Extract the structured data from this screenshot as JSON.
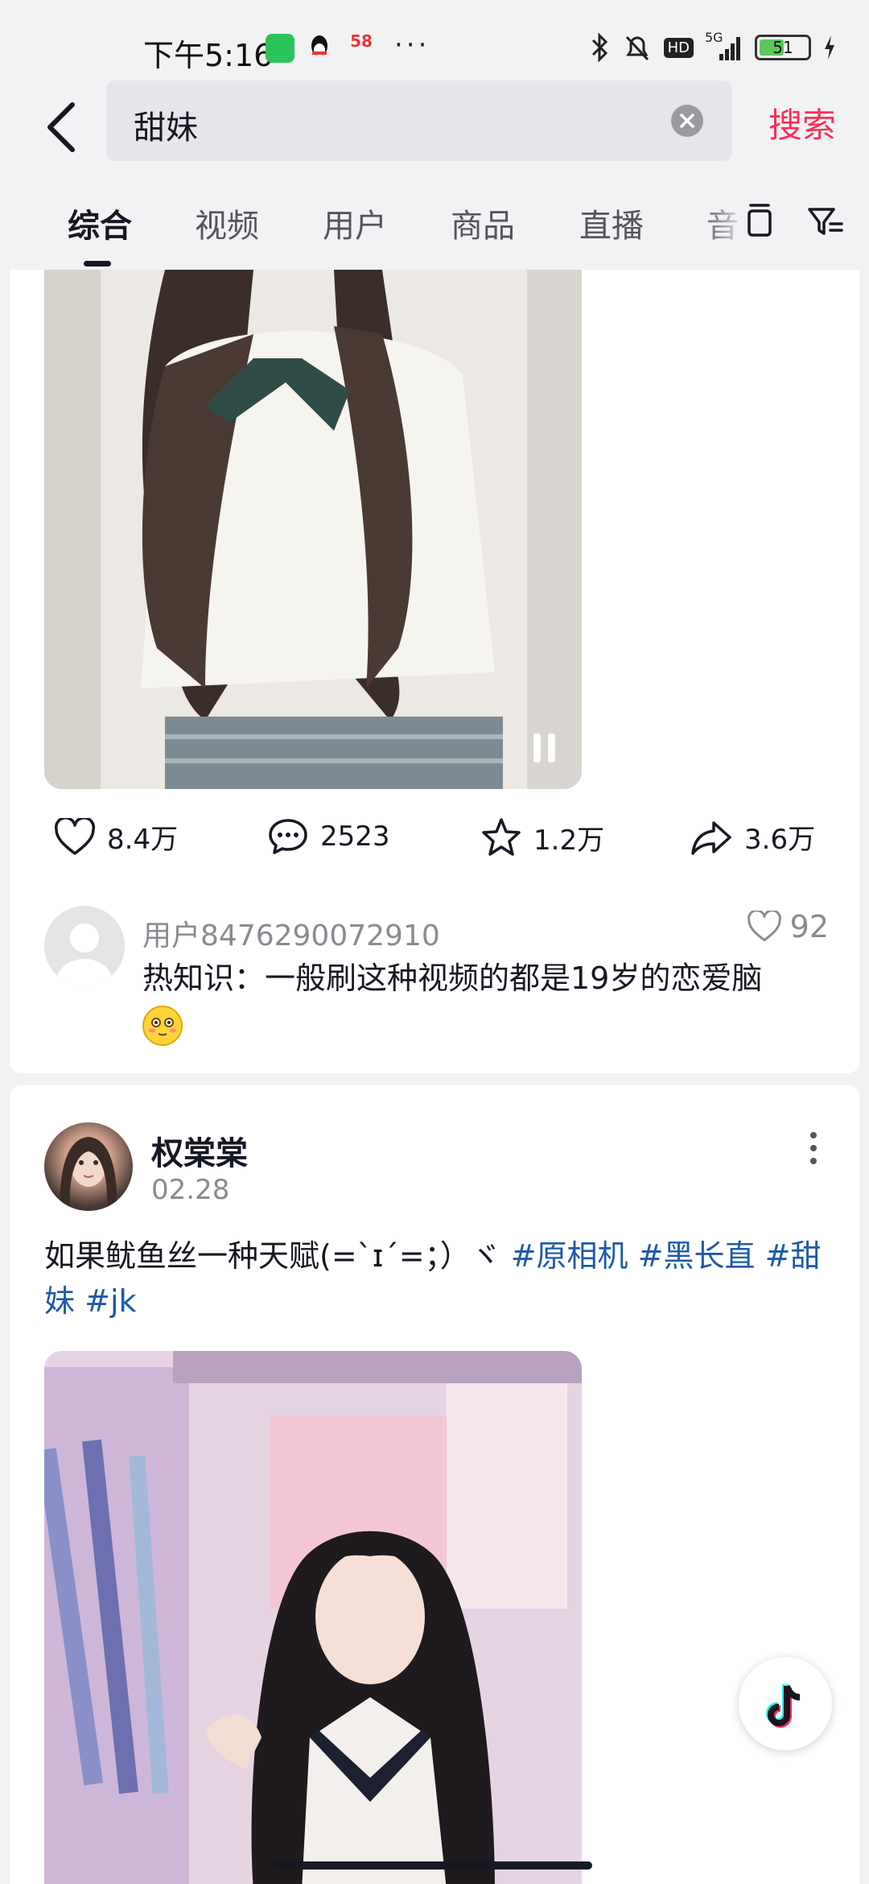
{
  "status_bar": {
    "time": "下午5:16",
    "app_58_label": "58",
    "more": "···",
    "network": "5G",
    "hd": "HD",
    "battery_level": "51",
    "battery_fraction": 0.51
  },
  "search": {
    "back_icon": "chevron-left-icon",
    "query": "甜妹",
    "clear_icon": "clear-circle-icon",
    "submit_label": "搜索"
  },
  "tabs": {
    "items": [
      "综合",
      "视频",
      "用户",
      "商品",
      "直播",
      "音"
    ],
    "active_index": 0
  },
  "post1": {
    "actions": {
      "likes": "8.4万",
      "comments": "2523",
      "favorites": "1.2万",
      "shares": "3.6万"
    },
    "top_comment": {
      "user": "用户8476290072910",
      "likes": "92",
      "text": "热知识：一般刷这种视频的都是19岁的恋爱脑"
    }
  },
  "post2": {
    "author": "权棠棠",
    "date": "02.28",
    "desc_text": "如果鱿鱼丝一种天赋(=`ɪ´=；）ヾ ",
    "tags": [
      "#原相机",
      "#黑长直",
      "#甜妹",
      "#jk"
    ]
  },
  "colors": {
    "accent": "#fe2c55",
    "tag": "#1e5aa8",
    "text": "#161823",
    "muted": "#8a8b91",
    "background": "#f2f2f4"
  }
}
